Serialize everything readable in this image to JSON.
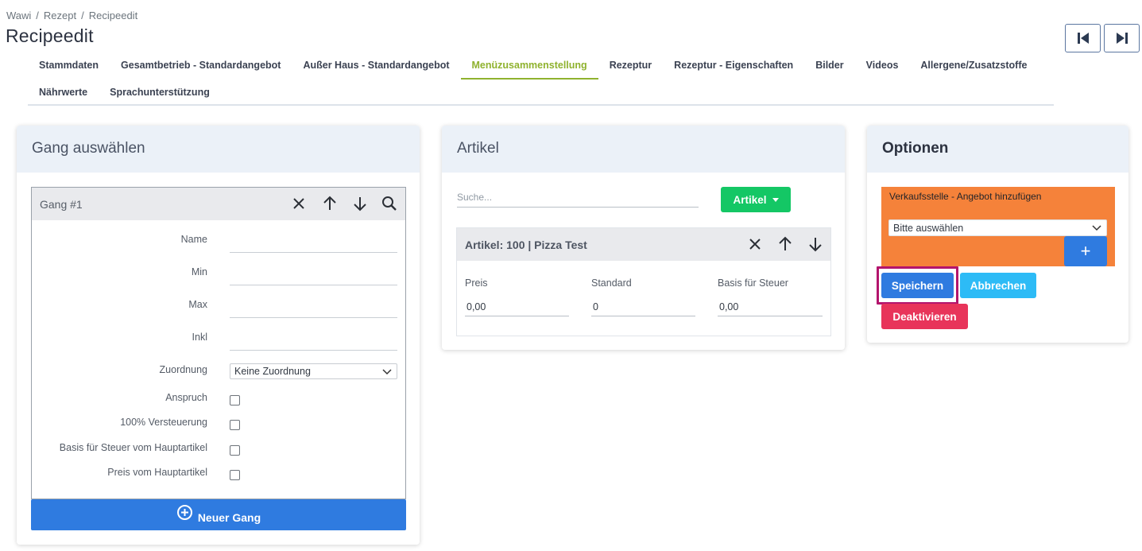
{
  "breadcrumb": [
    "Wawi",
    "Rezept",
    "Recipeedit"
  ],
  "breadcrumb_sep": "/",
  "page_title": "Recipeedit",
  "tabs_row1": [
    "Stammdaten",
    "Gesamtbetrieb - Standardangebot",
    "Außer Haus - Standardangebot",
    "Menüzusammenstellung",
    "Rezeptur",
    "Rezeptur - Eigenschaften",
    "Bilder",
    "Videos",
    "Allergene/Zusatzstoffe"
  ],
  "tabs_row2": [
    "Nährwerte",
    "Sprachunterstützung"
  ],
  "active_tab": "Menüzusammenstellung",
  "gang_card": {
    "title": "Gang auswählen",
    "gang_header": "Gang #1",
    "fields": {
      "name_label": "Name",
      "min_label": "Min",
      "max_label": "Max",
      "inkl_label": "Inkl",
      "zuordnung_label": "Zuordnung",
      "zuordnung_value": "Keine Zuordnung",
      "anspruch_label": "Anspruch",
      "versteuerung_label": "100% Versteuerung",
      "basis_label": "Basis für Steuer vom Hauptartikel",
      "preis_label": "Preis vom Hauptartikel"
    },
    "new_button": "Neuer Gang"
  },
  "artikel_card": {
    "title": "Artikel",
    "search_placeholder": "Suche...",
    "artikel_button": "Artikel",
    "item_header": "Artikel: 100 | Pizza Test",
    "preis_label": "Preis",
    "preis_value": "0,00",
    "standard_label": "Standard",
    "standard_value": "0",
    "basis_label": "Basis für Steuer",
    "basis_value": "0,00"
  },
  "optionen_card": {
    "title": "Optionen",
    "verkaufsstelle_label": "Verkaufsstelle - Angebot hinzufügen",
    "select_value": "Bitte auswählen",
    "plus_label": "+",
    "save": "Speichern",
    "cancel": "Abbrechen",
    "deactivate": "Deaktivieren"
  },
  "colors": {
    "accent_tab": "#8fb22e",
    "primary": "#2f7be0",
    "success": "#14c765",
    "info": "#2dbbf6",
    "danger": "#e8345a",
    "orange": "#f5823a",
    "highlight": "#b3156d"
  }
}
